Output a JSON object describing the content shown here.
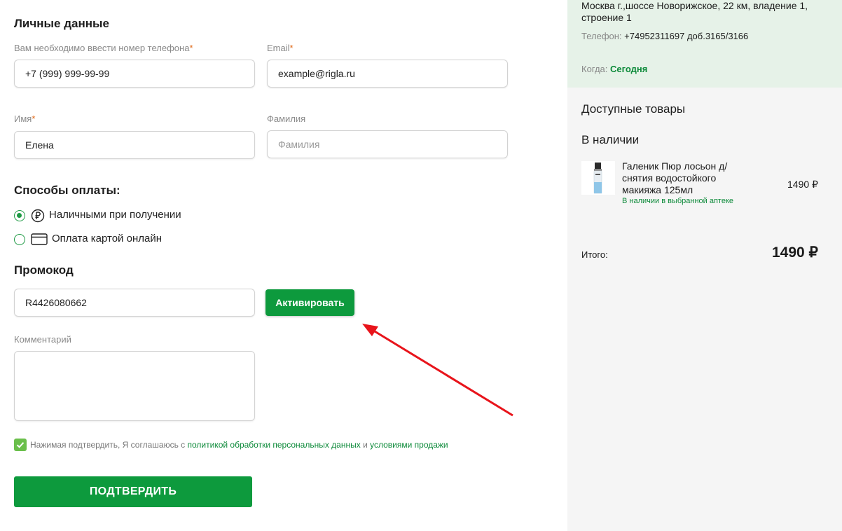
{
  "form": {
    "personal_title": "Личные данные",
    "phone_label": "Вам необходимо ввести номер телефона",
    "phone_value": "+7 (999) 999-99-99",
    "email_label": "Email",
    "email_value": "example@rigla.ru",
    "name_label": "Имя",
    "name_value": "Елена",
    "surname_label": "Фамилия",
    "surname_placeholder": "Фамилия",
    "required_mark": "*",
    "payment_title": "Способы оплаты:",
    "payment_options": [
      {
        "label": "Наличными при получении",
        "selected": true,
        "icon": "ruble-icon"
      },
      {
        "label": "Оплата картой онлайн",
        "selected": false,
        "icon": "credit-card-icon"
      }
    ],
    "promo_title": "Промокод",
    "promo_value": "R4426080662",
    "activate_label": "Активировать",
    "comment_label": "Комментарий",
    "agree_text": "Нажимая подтвердить, Я соглашаюсь с",
    "agree_link1": "политикой обработки персональных данных",
    "agree_and": "и",
    "agree_link2": "условиями продажи",
    "confirm_label": "ПОДТВЕРДИТЬ"
  },
  "store": {
    "address": "Москва г.,шоссе Новорижское, 22 км, владение 1, строение 1",
    "phone_label": "Телефон:",
    "phone_value": "+74952311697 доб.3165/3166",
    "when_label": "Когда:",
    "when_value": "Сегодня"
  },
  "cart": {
    "available_title": "Доступные товары",
    "in_stock_title": "В наличии",
    "items": [
      {
        "name": "Галеник Пюр лосьон д/снятия водостойкого макияжа 125мл",
        "availability": "В наличии в выбранной аптеке",
        "price": "1490 ₽"
      }
    ],
    "total_label": "Итого:",
    "total_value": "1490 ₽"
  },
  "colors": {
    "accent": "#0d9a3d",
    "annotation_arrow": "#e8141b"
  }
}
